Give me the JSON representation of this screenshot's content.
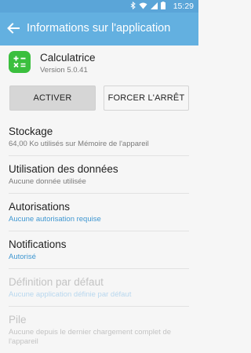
{
  "status": {
    "time": "15:29"
  },
  "appbar": {
    "title": "Informations sur l'application"
  },
  "app": {
    "name": "Calculatrice",
    "version": "Version 5.0.41"
  },
  "buttons": {
    "activate": "ACTIVER",
    "force_stop": "FORCER L'ARRÊT"
  },
  "rows": [
    {
      "title": "Stockage",
      "subtitle": "64,00 Ko utilisés sur Mémoire de l'appareil"
    },
    {
      "title": "Utilisation des données",
      "subtitle": "Aucune donnée utilisée"
    },
    {
      "title": "Autorisations",
      "subtitle": "Aucune autorisation requise"
    },
    {
      "title": "Notifications",
      "subtitle": "Autorisé"
    },
    {
      "title": "Définition par défaut",
      "subtitle": "Aucune application définie par défaut"
    },
    {
      "title": "Pile",
      "subtitle": "Aucune depuis le dernier chargement complet de l'appareil"
    }
  ]
}
